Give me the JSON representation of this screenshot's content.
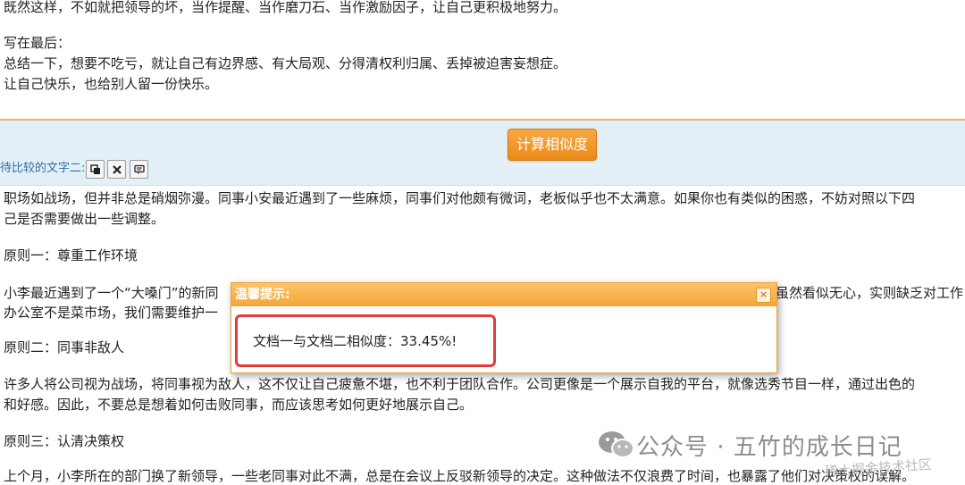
{
  "top_text": {
    "line1": "既然这样，不如就把领导的坏，当作提醒、当作磨刀石、当作激励因子，让自己更积极地努力。",
    "line2": "写在最后：",
    "line3": "总结一下，想要不吃亏，就让自己有边界感、有大局观、分得清权利归属、丢掉被迫害妄想症。",
    "line4": "让自己快乐，也给别人留一份快乐。"
  },
  "toolbar": {
    "calc_button": "计算相似度",
    "compare_label": "待比较的文字二:",
    "icons": [
      "copy-icon",
      "clear-icon",
      "comment-icon"
    ]
  },
  "body_text": {
    "p1a": "职场如战场，但并非总是硝烟弥漫。同事小安最近遇到了一些麻烦，同事们对他颇有微词，老板似乎也不太满意。如果你也有类似的困惑，不妨对照以下四",
    "p1b": "己是否需要做出一些调整。",
    "h1": "原则一：尊重工作环境",
    "p2a_left": "小李最近遇到了一个“大嗓门”的新同",
    "p2a_right": "虽然看似无心，实则缺乏对工作",
    "p2b": "办公室不是菜市场，我们需要维护一",
    "h2": "原则二：同事非敌人",
    "p3a": "许多人将公司视为战场，将同事视为敌人，这不仅让自己疲惫不堪，也不利于团队合作。公司更像是一个展示自我的平台，就像选秀节目一样，通过出色的",
    "p3b": "和好感。因此，不要总是想着如何击败同事，而应该思考如何更好地展示自己。",
    "h3": "原则三：认清决策权",
    "p4a": "上个月，小李所在的部门换了新领导，一些老同事对此不满，总是在会议上反驳新领导的决定。这种做法不仅浪费了时间，也暴露了他们对决策权的误解。"
  },
  "dialog": {
    "title": "温馨提示:",
    "close": "×",
    "message": "文档一与文档二相似度：33.45%!"
  },
  "watermark": {
    "text": "公众号 · 五竹的成长日记",
    "sub": "稀土掘金技术社区"
  }
}
